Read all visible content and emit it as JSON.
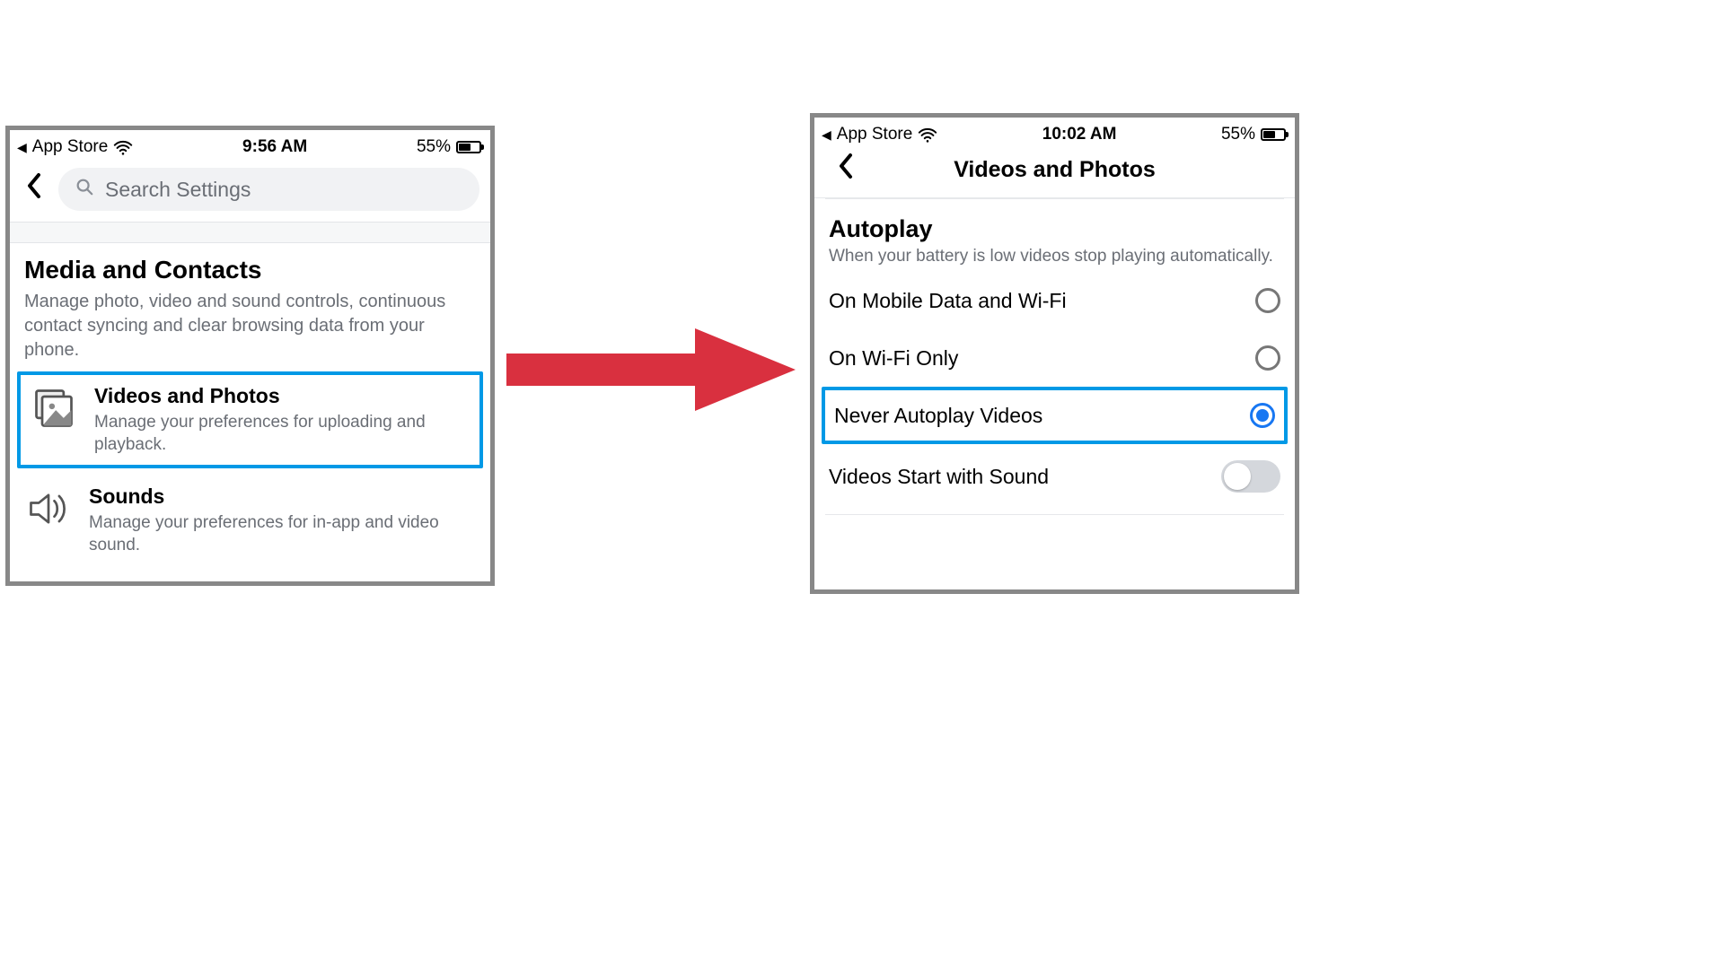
{
  "left": {
    "status": {
      "back_label": "App Store",
      "time": "9:56 AM",
      "battery": "55%"
    },
    "search_placeholder": "Search Settings",
    "section": {
      "title": "Media and Contacts",
      "desc": "Manage photo, video and sound controls, continuous contact syncing and clear browsing data from your phone."
    },
    "items": [
      {
        "title": "Videos and Photos",
        "desc": "Manage your preferences for uploading and playback.",
        "highlighted": true
      },
      {
        "title": "Sounds",
        "desc": "Manage your preferences for in-app and video sound.",
        "highlighted": false
      }
    ]
  },
  "right": {
    "status": {
      "back_label": "App Store",
      "time": "10:02 AM",
      "battery": "55%"
    },
    "page_title": "Videos and Photos",
    "autoplay": {
      "title": "Autoplay",
      "desc": "When your battery is low videos stop playing automatically.",
      "options": [
        {
          "label": "On Mobile Data and Wi-Fi",
          "selected": false,
          "highlighted": false
        },
        {
          "label": "On Wi-Fi Only",
          "selected": false,
          "highlighted": false
        },
        {
          "label": "Never Autoplay Videos",
          "selected": true,
          "highlighted": true
        }
      ]
    },
    "sound_toggle": {
      "label": "Videos Start with Sound",
      "on": false
    }
  }
}
